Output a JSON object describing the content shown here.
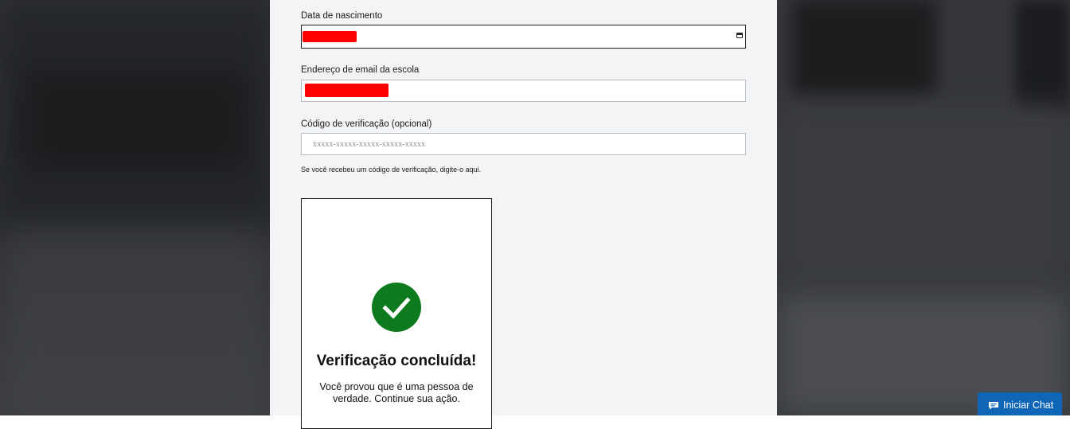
{
  "form": {
    "birthdate": {
      "label": "Data de nascimento",
      "value_redacted": true
    },
    "school_email": {
      "label": "Endereço de email da escola",
      "value_redacted": true
    },
    "verification_code": {
      "label": "Código de verificação (opcional)",
      "placeholder": "xxxxx-xxxxx-xxxxx-xxxxx-xxxxx",
      "value": "",
      "hint": "Se você recebeu um código de verificação, digite-o aqui."
    }
  },
  "captcha": {
    "title": "Verificação concluída!",
    "message": "Você provou que é uma pessoa de verdade. Continue sua ação.",
    "status_icon": "checkmark-icon",
    "status_color": "#0e7a1e"
  },
  "chat": {
    "label": "Iniciar Chat",
    "icon": "chat-bubble-icon",
    "color": "#0f65b6"
  },
  "colors": {
    "panel_bg": "#f3f4f6",
    "redaction": "#ff0000"
  }
}
